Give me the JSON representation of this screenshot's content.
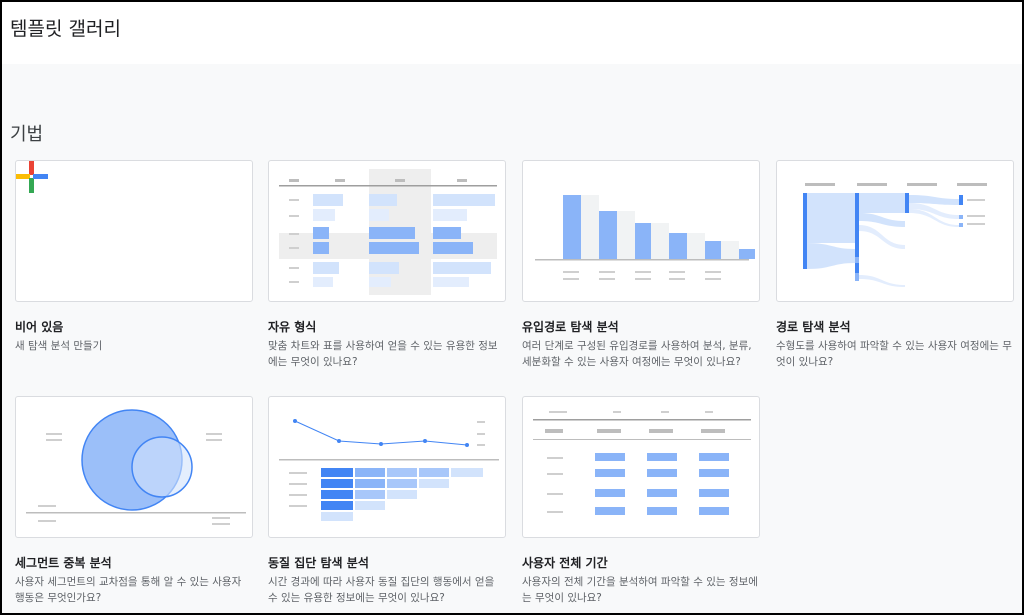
{
  "header": {
    "title": "템플릿 갤러리"
  },
  "section": {
    "title": "기법"
  },
  "colors": {
    "blue": "#8ab4f8",
    "blue_dark": "#4285f4",
    "blue_light": "#d2e3fc",
    "gray_bar": "#dadce0",
    "red": "#ea4335",
    "yellow": "#fbbc04",
    "green": "#34a853"
  },
  "cards": [
    {
      "title": "비어 있음",
      "desc": "새 탐색 분석 만들기",
      "icon": "plus-icon"
    },
    {
      "title": "자유 형식",
      "desc": "맞춤 차트와 표를 사용하여 얻을 수 있는 유용한 정보에는 무엇이 있나요?"
    },
    {
      "title": "유입경로 탐색 분석",
      "desc": "여러 단계로 구성된 유입경로를 사용하여 분석, 분류, 세분화할 수 있는 사용자 여정에는 무엇이 있나요?"
    },
    {
      "title": "경로 탐색 분석",
      "desc": "수형도를 사용하여 파악할 수 있는 사용자 여정에는 무엇이 있나요?"
    },
    {
      "title": "세그먼트 중복 분석",
      "desc": "사용자 세그먼트의 교차점을 통해 알 수 있는 사용자 행동은 무엇인가요?"
    },
    {
      "title": "동질 집단 탐색 분석",
      "desc": "시간 경과에 따라 사용자 동질 집단의 행동에서 얻을 수 있는 유용한 정보에는 무엇이 있나요?"
    },
    {
      "title": "사용자 전체 기간",
      "desc": "사용자의 전체 기간을 분석하여 파악할 수 있는 정보에는 무엇이 있나요?"
    }
  ]
}
